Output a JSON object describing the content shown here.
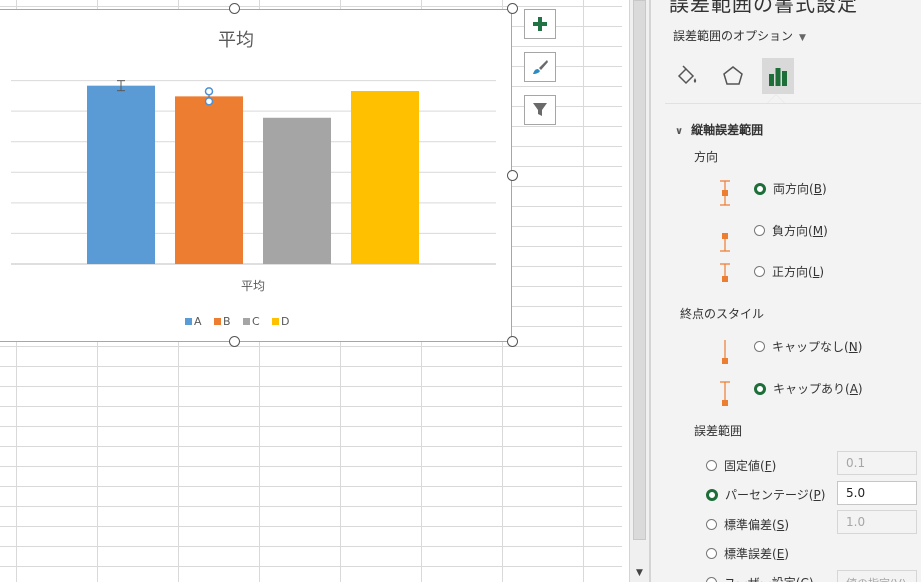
{
  "chart_data": {
    "type": "bar",
    "title": "平均",
    "categories": [
      "平均"
    ],
    "series": [
      {
        "name": "A",
        "values": [
          100
        ],
        "color": "#5b9bd5",
        "error_bar": true
      },
      {
        "name": "B",
        "values": [
          94
        ],
        "color": "#ed7d31",
        "error_bar": true,
        "selected": true
      },
      {
        "name": "C",
        "values": [
          82
        ],
        "color": "#a5a5a5"
      },
      {
        "name": "D",
        "values": [
          97
        ],
        "color": "#ffc000"
      }
    ],
    "ylim": [
      0,
      120
    ],
    "gridlines": true,
    "legend": "bottom"
  },
  "chart_buttons": {
    "elements": "chart-elements",
    "styles": "chart-styles",
    "filters": "chart-filters"
  },
  "pane": {
    "title": "誤差範囲の書式設定",
    "options_dropdown": "誤差範囲のオプション",
    "section_header": "縦軸誤差範囲",
    "direction_label": "方向",
    "direction_options": [
      {
        "label": "両方向",
        "key": "B",
        "selected": true
      },
      {
        "label": "負方向",
        "key": "M",
        "selected": false
      },
      {
        "label": "正方向",
        "key": "L",
        "selected": false
      }
    ],
    "end_style_label": "終点のスタイル",
    "end_style_options": [
      {
        "label": "キャップなし",
        "key": "N",
        "selected": false
      },
      {
        "label": "キャップあり",
        "key": "A",
        "selected": true
      }
    ],
    "amount_label": "誤差範囲",
    "amount_options": [
      {
        "label": "固定値",
        "key": "F",
        "selected": false,
        "value": "0.1",
        "enabled": false
      },
      {
        "label": "パーセンテージ",
        "key": "P",
        "selected": true,
        "value": "5.0",
        "enabled": true
      },
      {
        "label": "標準偏差",
        "key": "S",
        "selected": false,
        "value": "1.0",
        "enabled": false
      },
      {
        "label": "標準誤差",
        "key": "E",
        "selected": false
      },
      {
        "label": "ユーザー設定",
        "key": "C",
        "selected": false,
        "value": "値の指定(V)"
      }
    ],
    "accent_color": "#1e6e3a"
  }
}
